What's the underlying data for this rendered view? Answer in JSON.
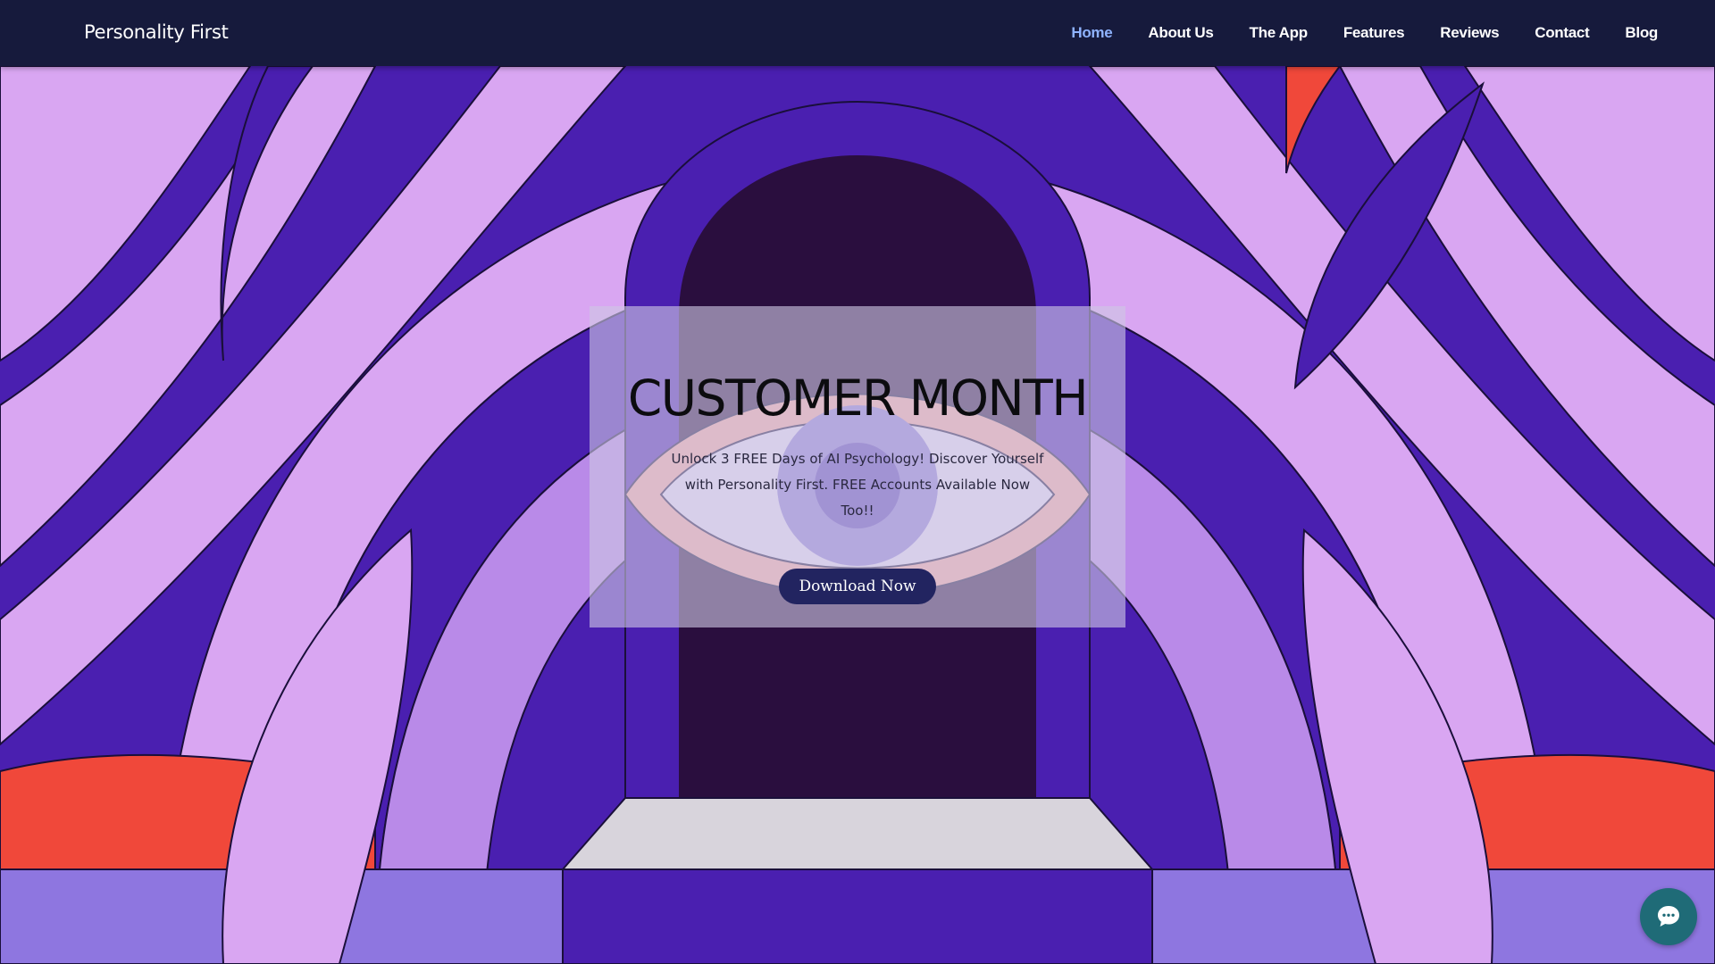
{
  "header": {
    "brand": "Personality First",
    "nav": [
      {
        "label": "Home",
        "active": true
      },
      {
        "label": "About Us",
        "active": false
      },
      {
        "label": "The App",
        "active": false
      },
      {
        "label": "Features",
        "active": false
      },
      {
        "label": "Reviews",
        "active": false
      },
      {
        "label": "Contact",
        "active": false
      },
      {
        "label": "Blog",
        "active": false
      }
    ]
  },
  "promo": {
    "title": "CUSTOMER MONTH",
    "subtitle": "Unlock 3 FREE Days of AI Psychology! Discover Yourself with Personality First. FREE Accounts Available Now Too!!",
    "button_label": "Download Now"
  },
  "chat": {
    "icon": "chat-bubble-icon"
  },
  "colors": {
    "header_bg": "#161a3c",
    "nav_active": "#8fb3ff",
    "button_bg": "#222460",
    "hero_purple": "#4a1fb0",
    "hero_lavender": "#d9a6f2",
    "hero_red": "#f0483a",
    "chat_bg": "#1f6b77"
  }
}
